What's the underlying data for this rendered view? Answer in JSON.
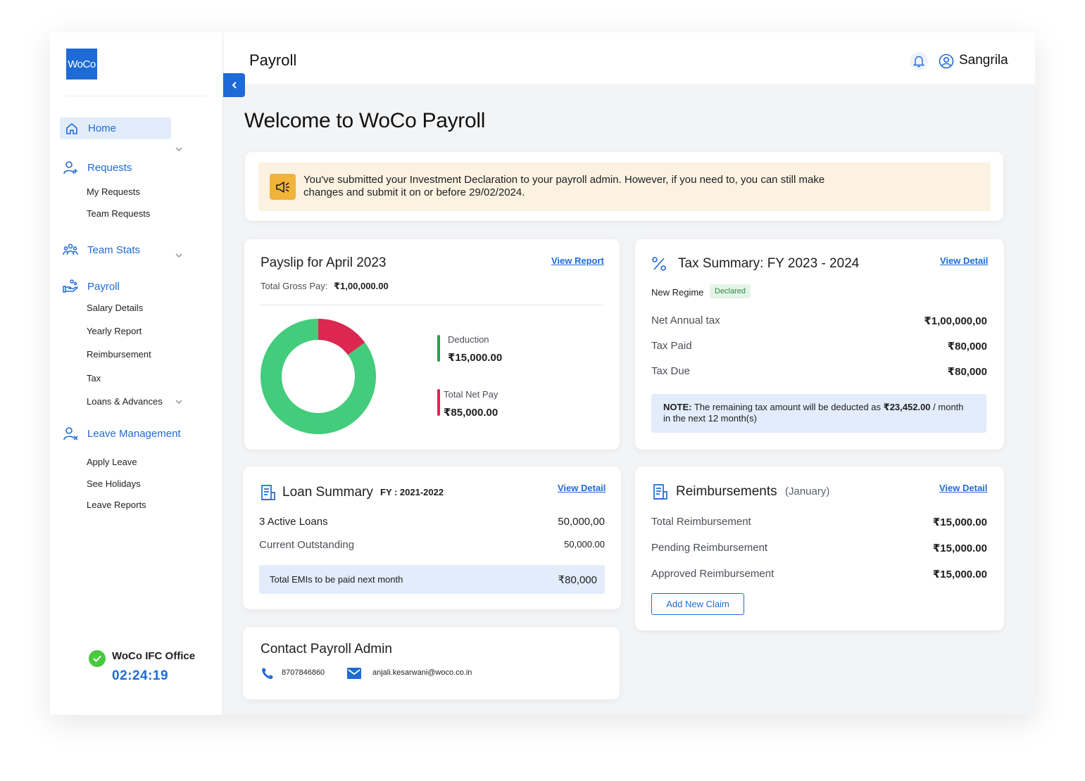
{
  "app": {
    "logo_text": "WoCo",
    "page_title": "Payroll",
    "user_name": "Sangrila"
  },
  "sidebar": {
    "home": "Home",
    "requests": {
      "label": "Requests",
      "items": [
        "My Requests",
        "Team Requests"
      ]
    },
    "team_stats": "Team Stats",
    "payroll": {
      "label": "Payroll",
      "items": [
        "Salary Details",
        "Yearly Report",
        "Reimbursement",
        "Tax",
        "Loans & Advances"
      ]
    },
    "leave": {
      "label": "Leave Management",
      "items": [
        "Apply Leave",
        "See Holidays",
        "Leave Reports"
      ]
    },
    "office": {
      "name": "WoCo IFC Office",
      "timer": "02:24:19"
    }
  },
  "welcome": "Welcome to WoCo Payroll",
  "notice": {
    "line1": "You've submitted your Investment Declaration to your payroll admin. However, if you need to, you can still make",
    "line2": "changes and submit it on or before 29/02/2024."
  },
  "payslip": {
    "title": "Payslip for April 2023",
    "link": "View Report",
    "gross_label": "Total Gross Pay:",
    "gross_value": "₹1,00,000.00",
    "deduction_label": "Deduction",
    "deduction_value": "₹15,000.00",
    "net_label": "Total Net Pay",
    "net_value": "₹85,000.00",
    "chart_data": {
      "type": "pie",
      "categories": [
        "Deduction",
        "Total Net Pay"
      ],
      "values": [
        15000,
        85000
      ],
      "colors": [
        "#dc2750",
        "#43cc7b"
      ]
    }
  },
  "tax": {
    "title": "Tax Summary: FY 2023 - 2024",
    "link": "View Detail",
    "regime": "New Regime",
    "status": "Declared",
    "rows": [
      {
        "label": "Net Annual tax",
        "value": "₹1,00,000,00"
      },
      {
        "label": "Tax Paid",
        "value": "₹80,000"
      },
      {
        "label": "Tax Due",
        "value": "₹80,000"
      }
    ],
    "note_prefix": "NOTE:",
    "note_text": " The remaining tax amount will be deducted as ",
    "note_amount": "₹23,452.00",
    "note_suffix": " / month",
    "note_line2": "in the next 12 month(s)"
  },
  "loan": {
    "title": "Loan Summary",
    "fy": "FY : 2021-2022",
    "link": "View Detail",
    "active_label": "3 Active Loans",
    "active_value": "50,000,00",
    "outstanding_label": "Current Outstanding",
    "outstanding_value": "50,000.00",
    "emi_label": "Total EMIs to be paid next month",
    "emi_value": "₹80,000"
  },
  "reimb": {
    "title": "Reimbursements",
    "period": "(January)",
    "link": "View Detail",
    "rows": [
      {
        "label": "Total Reimbursement",
        "value": "₹15,000.00"
      },
      {
        "label": "Pending Reimbursement",
        "value": "₹15,000.00"
      },
      {
        "label": "Approved Reimbursement",
        "value": "₹15,000.00"
      }
    ],
    "button": "Add New Claim"
  },
  "contact": {
    "title": "Contact Payroll Admin",
    "phone": "8707846860",
    "email": "anjali.kesarwani@woco.co.in"
  }
}
